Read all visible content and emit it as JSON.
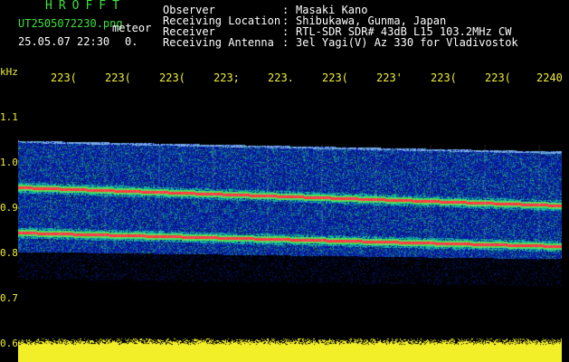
{
  "header": {
    "app_title": "HROFFT",
    "filename": "UT2505072230.png",
    "subtitle": "meteor",
    "datetime": "25.05.07 22:30",
    "count": "0."
  },
  "meta": [
    {
      "label": "Observer",
      "sep": ":",
      "value": "Masaki Kano"
    },
    {
      "label": "Receiving Location",
      "sep": ":",
      "value": "Shibukawa, Gunma, Japan"
    },
    {
      "label": "Receiver",
      "sep": ":",
      "value": "RTL-SDR SDR# 43dB L15 103.2MHz CW"
    },
    {
      "label": "Receiving Antenna",
      "sep": ":",
      "value": "3el Yagi(V) Az 330 for Vladivostok"
    }
  ],
  "axis": {
    "unit": "kHz",
    "time_ticks": [
      "223(",
      "223(",
      "223(",
      "223;",
      "223.",
      "223(",
      "223'",
      "223(",
      "223(",
      "2240"
    ],
    "freq_ticks": [
      "1.1",
      "1.0",
      "0.9",
      "0.8",
      "0.7",
      "0.6"
    ]
  },
  "colors": {
    "header_green": "#3ee03e",
    "meta_white": "#ffffff",
    "axis_yellow": "#f2ee3a",
    "noise_floor": "#0b1c8c",
    "carrier_red": "#ff2a2a",
    "signal_green": "#2ee86a"
  }
}
